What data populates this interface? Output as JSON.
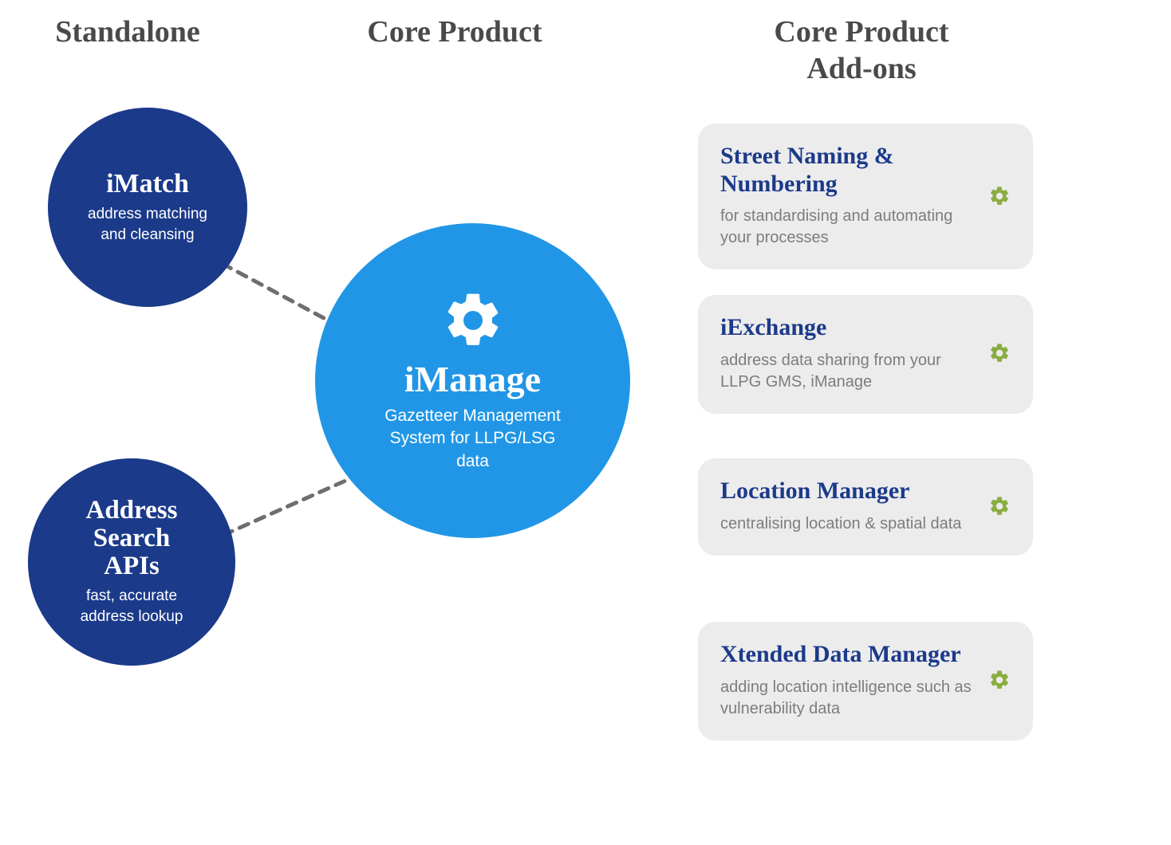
{
  "columns": {
    "standalone": "Standalone",
    "core": "Core Product",
    "addons_line1": "Core Product",
    "addons_line2": "Add-ons"
  },
  "standalone": [
    {
      "title": "iMatch",
      "desc": "address matching and cleansing"
    },
    {
      "title": "Address Search APIs",
      "desc": "fast, accurate address lookup"
    }
  ],
  "core": {
    "title": "iManage",
    "desc": "Gazetteer Management System for LLPG/LSG data"
  },
  "addons": [
    {
      "title": "Street Naming & Numbering",
      "desc": "for standardising and automating your processes"
    },
    {
      "title": "iExchange",
      "desc": "address data sharing from your LLPG GMS, iManage"
    },
    {
      "title": "Location Manager",
      "desc": "centralising location & spatial data"
    },
    {
      "title": "Xtended Data Manager",
      "desc": "adding location intelligence such as vulnerability data"
    }
  ],
  "colors": {
    "darkBlue": "#1b3a8a",
    "coreBlue": "#2196e6",
    "headerGray": "#4a4a4a",
    "cardBg": "#ececec",
    "descGray": "#7d7d7d",
    "gearGreen": "#8aad3f",
    "connectorGray": "#6e6e6e"
  }
}
